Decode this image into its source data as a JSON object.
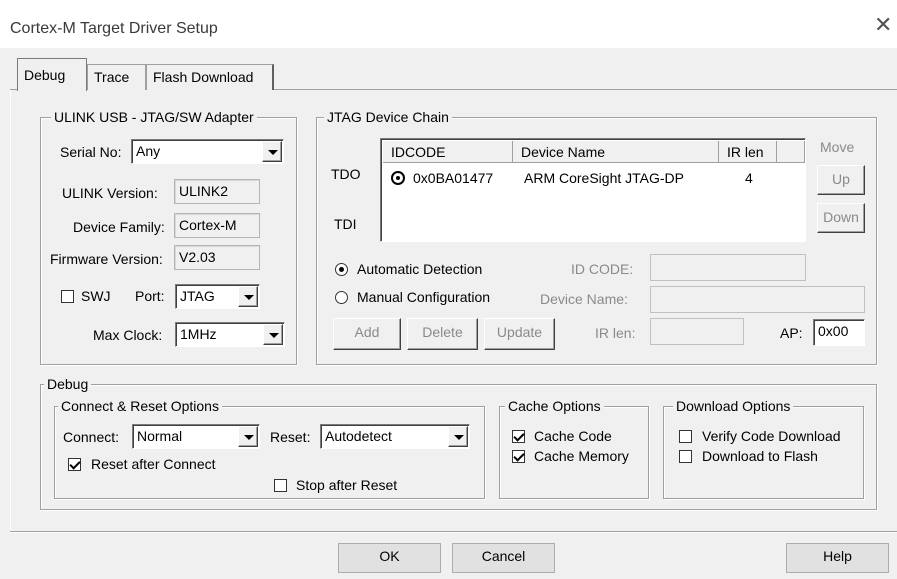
{
  "window": {
    "title": "Cortex-M Target Driver Setup",
    "close_glyph": "✕"
  },
  "tabs": [
    {
      "label": "Debug",
      "active": true
    },
    {
      "label": "Trace",
      "active": false
    },
    {
      "label": "Flash Download",
      "active": false
    }
  ],
  "adapter": {
    "title": "ULINK USB - JTAG/SW Adapter",
    "serial_label": "Serial No:",
    "serial_value": "Any",
    "version_label": "ULINK Version:",
    "version_value": "ULINK2",
    "family_label": "Device Family:",
    "family_value": "Cortex-M",
    "firmware_label": "Firmware Version:",
    "firmware_value": "V2.03",
    "swj_label": "SWJ",
    "swj_checked": false,
    "port_label": "Port:",
    "port_value": "JTAG",
    "clock_label": "Max Clock:",
    "clock_value": "1MHz"
  },
  "chain": {
    "title": "JTAG Device Chain",
    "tdo": "TDO",
    "tdi": "TDI",
    "columns": [
      "IDCODE",
      "Device Name",
      "IR len"
    ],
    "rows": [
      {
        "idcode": "0x0BA01477",
        "name": "ARM CoreSight JTAG-DP",
        "irlen": "4"
      }
    ],
    "move_label": "Move",
    "up_label": "Up",
    "down_label": "Down",
    "auto_label": "Automatic Detection",
    "manual_label": "Manual Configuration",
    "mode": "auto",
    "idcode_label": "ID CODE:",
    "devname_label": "Device Name:",
    "irlen_label": "IR len:",
    "ap_label": "AP:",
    "ap_value": "0x00",
    "add_label": "Add",
    "delete_label": "Delete",
    "update_label": "Update"
  },
  "debug": {
    "title": "Debug",
    "connect_reset": {
      "title": "Connect & Reset Options",
      "connect_label": "Connect:",
      "connect_value": "Normal",
      "reset_label": "Reset:",
      "reset_value": "Autodetect",
      "reset_after_label": "Reset after Connect",
      "reset_after_checked": true,
      "stop_after_label": "Stop after Reset",
      "stop_after_checked": false
    },
    "cache": {
      "title": "Cache Options",
      "code_label": "Cache Code",
      "code_checked": true,
      "memory_label": "Cache Memory",
      "memory_checked": true
    },
    "download": {
      "title": "Download Options",
      "verify_label": "Verify Code Download",
      "verify_checked": false,
      "flash_label": "Download to Flash",
      "flash_checked": false
    }
  },
  "buttons": {
    "ok": "OK",
    "cancel": "Cancel",
    "help": "Help"
  }
}
